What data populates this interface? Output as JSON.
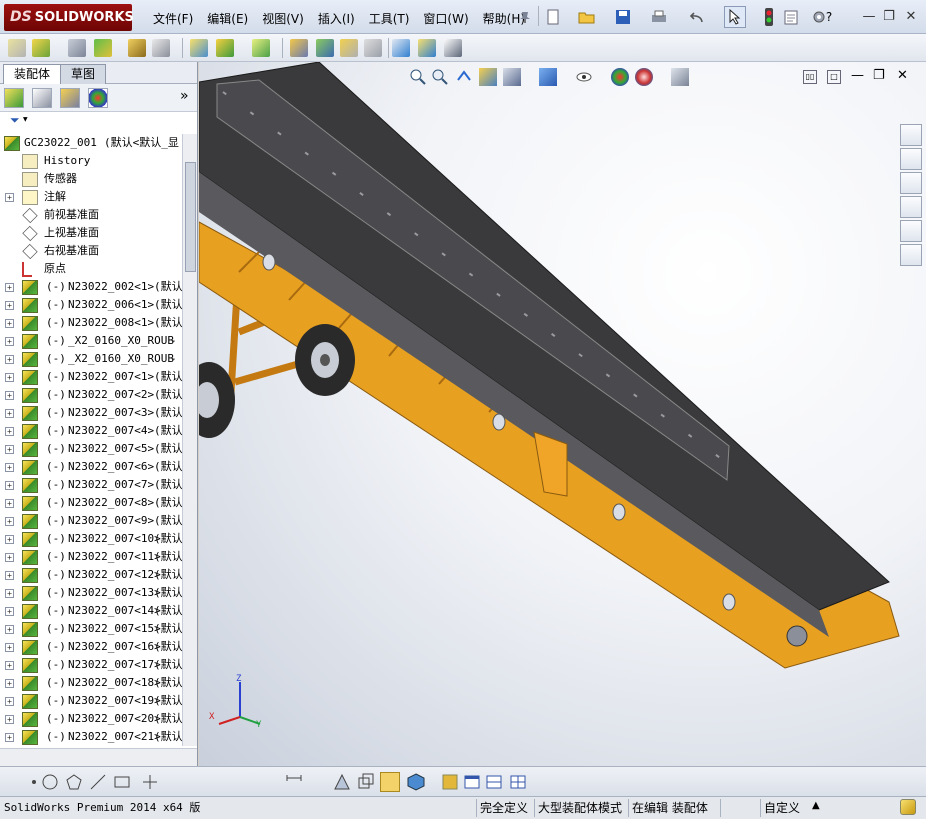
{
  "app": {
    "logo_ds": "DS",
    "logo_text": "SOLIDWORKS",
    "menu": [
      "文件(F)",
      "编辑(E)",
      "视图(V)",
      "插入(I)",
      "工具(T)",
      "窗口(W)",
      "帮助(H)"
    ],
    "help_mark": "?"
  },
  "window_controls": {
    "minimize": "—",
    "restore": "❐",
    "close": "✕"
  },
  "panel": {
    "tabs": [
      "装配体",
      "草图"
    ],
    "chevron": "»",
    "filter_icon": "▼"
  },
  "tree": {
    "root": {
      "name": "GC23022_001",
      "config": "(默认<默认_显"
    },
    "fixed_items": [
      {
        "label": "History",
        "icon": "history-icon"
      },
      {
        "label": "传感器",
        "icon": "sensor-icon"
      },
      {
        "label": "注解",
        "icon": "annotation-icon",
        "expandable": true
      },
      {
        "label": "前视基准面",
        "icon": "plane-icon"
      },
      {
        "label": "上视基准面",
        "icon": "plane-icon"
      },
      {
        "label": "右视基准面",
        "icon": "plane-icon"
      },
      {
        "label": "原点",
        "icon": "origin-icon"
      }
    ],
    "components": [
      {
        "state": "(-)",
        "name": "N23022_002<1>",
        "config": "(默认"
      },
      {
        "state": "(-)",
        "name": "N23022_006<1>",
        "config": "(默认"
      },
      {
        "state": "(-)",
        "name": "N23022_008<1>",
        "config": "(默认"
      },
      {
        "state": "(-)",
        "name": "_X2_0160_X0_ROUB",
        "config": "-"
      },
      {
        "state": "(-)",
        "name": "_X2_0160_X0_ROUB",
        "config": "-"
      },
      {
        "state": "(-)",
        "name": "N23022_007<1>",
        "config": "(默认"
      },
      {
        "state": "(-)",
        "name": "N23022_007<2>",
        "config": "(默认"
      },
      {
        "state": "(-)",
        "name": "N23022_007<3>",
        "config": "(默认"
      },
      {
        "state": "(-)",
        "name": "N23022_007<4>",
        "config": "(默认"
      },
      {
        "state": "(-)",
        "name": "N23022_007<5>",
        "config": "(默认"
      },
      {
        "state": "(-)",
        "name": "N23022_007<6>",
        "config": "(默认"
      },
      {
        "state": "(-)",
        "name": "N23022_007<7>",
        "config": "(默认"
      },
      {
        "state": "(-)",
        "name": "N23022_007<8>",
        "config": "(默认"
      },
      {
        "state": "(-)",
        "name": "N23022_007<9>",
        "config": "(默认"
      },
      {
        "state": "(-)",
        "name": "N23022_007<10>",
        "config": "(默认"
      },
      {
        "state": "(-)",
        "name": "N23022_007<11>",
        "config": "(默认"
      },
      {
        "state": "(-)",
        "name": "N23022_007<12>",
        "config": "(默认"
      },
      {
        "state": "(-)",
        "name": "N23022_007<13>",
        "config": "(默认"
      },
      {
        "state": "(-)",
        "name": "N23022_007<14>",
        "config": "(默认"
      },
      {
        "state": "(-)",
        "name": "N23022_007<15>",
        "config": "(默认"
      },
      {
        "state": "(-)",
        "name": "N23022_007<16>",
        "config": "(默认"
      },
      {
        "state": "(-)",
        "name": "N23022_007<17>",
        "config": "(默认"
      },
      {
        "state": "(-)",
        "name": "N23022_007<18>",
        "config": "(默认"
      },
      {
        "state": "(-)",
        "name": "N23022_007<19>",
        "config": "(默认"
      },
      {
        "state": "(-)",
        "name": "N23022_007<20>",
        "config": "(默认"
      },
      {
        "state": "(-)",
        "name": "N23022_007<21>",
        "config": "(默认"
      }
    ]
  },
  "triad": {
    "x": "X",
    "y": "Y",
    "z": "Z"
  },
  "status": {
    "product": "SolidWorks Premium 2014 x64 版",
    "cells": [
      "完全定义",
      "大型装配体模式",
      "在编辑 装配体",
      "自定义"
    ],
    "dropdown": "▲"
  },
  "colors": {
    "frame_orange": "#E8A020",
    "belt": "#3A3A3C",
    "viewport_center": "#FFFFFF",
    "viewport_edge": "#C9D0DC"
  }
}
